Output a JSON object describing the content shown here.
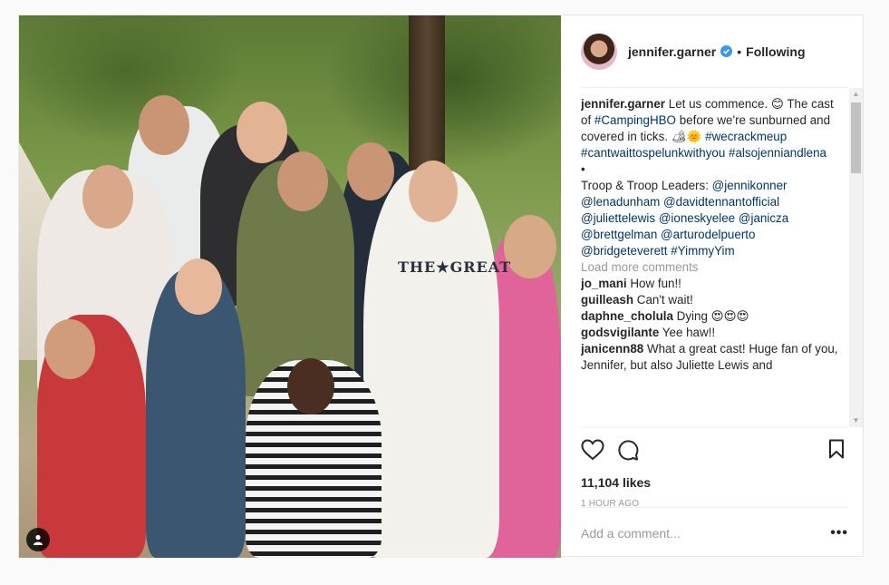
{
  "post": {
    "username": "jennifer.garner",
    "separator": "•",
    "follow_status": "Following",
    "photo": {
      "shirt_print": "THE★GREAT"
    },
    "caption": {
      "username": "jennifer.garner",
      "text_1": "Let us commence. 😊 The cast of",
      "hashtag_1": "#CampingHBO",
      "text_2": "before we're sunburned and covered in ticks. 🏕🌞",
      "hashtag_2": "#wecrackmeup",
      "hashtag_3": "#cantwaittospelunkwithyou",
      "hashtag_4": "#alsojenniandlena",
      "bullet": "•",
      "text_3": "Troop & Troop Leaders:",
      "mention_1": "@jennikonner",
      "mention_2": "@lenadunham",
      "mention_3": "@davidtennantofficial",
      "mention_4": "@juliettelewis",
      "mention_5": "@ioneskyelee",
      "mention_6": "@janicza",
      "mention_7": "@brettgelman",
      "mention_8": "@arturodelpuerto",
      "mention_9": "@bridgeteverett",
      "hashtag_5": "#YimmyYim"
    },
    "load_more": "Load more comments",
    "comments": [
      {
        "user": "jo_mani",
        "text": "How fun!!"
      },
      {
        "user": "guilleash",
        "text": "Can't wait!"
      },
      {
        "user": "daphne_cholula",
        "text": "Dying 😍😍😍"
      },
      {
        "user": "godsvigilante",
        "text": "Yee haw!!"
      },
      {
        "user": "janicenn88",
        "text": "What a great cast! Huge fan of you, Jennifer, but also Juliette Lewis and"
      }
    ],
    "likes": "11,104 likes",
    "timestamp": "1 HOUR AGO",
    "add_comment_placeholder": "Add a comment...",
    "more_options": "•••"
  },
  "icons": {
    "verified": "verified-badge-icon",
    "like": "heart-icon",
    "comment": "comment-bubble-icon",
    "save": "bookmark-icon",
    "user_tag": "person-tag-icon"
  },
  "colors": {
    "link": "#003569",
    "verified": "#3897f0",
    "muted": "#999999"
  }
}
